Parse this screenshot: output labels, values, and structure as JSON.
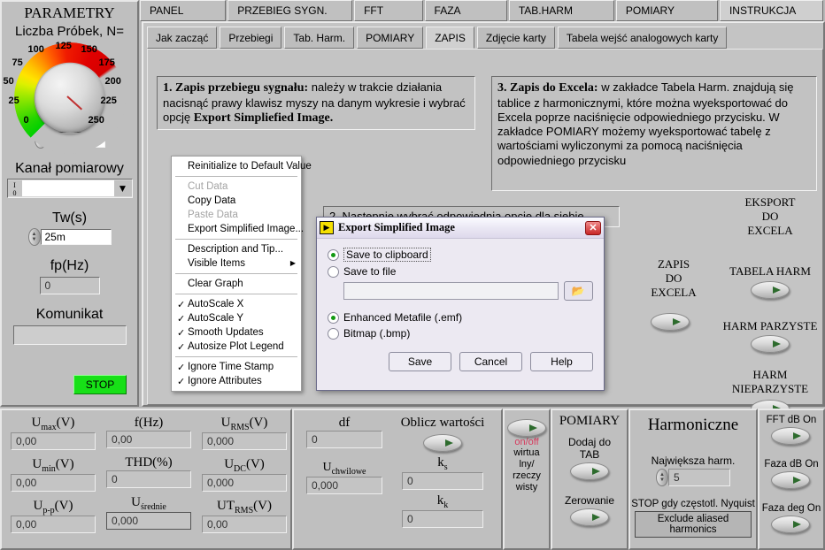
{
  "left_panel": {
    "title": "PARAMETRY",
    "samples_label": "Liczba Próbek, N=",
    "knob": {
      "value": "250",
      "ticks": [
        "0",
        "25",
        "50",
        "75",
        "100",
        "125",
        "150",
        "175",
        "200",
        "225",
        "250"
      ],
      "min": 0,
      "max": 250,
      "colors": {
        "low": "#00d000",
        "mid": "#ffe400",
        "high": "#d40000"
      }
    },
    "channel_label": "Kanał pomiarowy",
    "channel_value": "",
    "channel_io_icon": "io-icon",
    "tw_label": "Tw(s)",
    "tw_value": "25m",
    "fp_label": "fp(Hz)",
    "fp_value": "0",
    "komunikat_label": "Komunikat",
    "komunikat_value": "",
    "stop_label": "STOP",
    "stop_color": "#17e017"
  },
  "outer_tabs": [
    {
      "label": "PANEL",
      "selected": false
    },
    {
      "label": "PRZEBIEG SYGN.",
      "selected": false
    },
    {
      "label": "FFT",
      "selected": false
    },
    {
      "label": "FAZA",
      "selected": false
    },
    {
      "label": "TAB.HARM",
      "selected": false
    },
    {
      "label": "POMIARY",
      "selected": false
    },
    {
      "label": "INSTRUKCJA",
      "selected": true
    }
  ],
  "inner_tabs": [
    {
      "label": "Jak zacząć",
      "selected": false
    },
    {
      "label": "Przebiegi",
      "selected": false
    },
    {
      "label": "Tab. Harm.",
      "selected": false
    },
    {
      "label": "POMIARY",
      "selected": false
    },
    {
      "label": "ZAPIS",
      "selected": true
    },
    {
      "label": "Zdjęcie karty",
      "selected": false
    },
    {
      "label": "Tabela wejść analogowych karty",
      "selected": false
    }
  ],
  "instructions": {
    "step1_head": "1. Zapis przebiegu sygnału:",
    "step1_body": " należy w trakcie działania nacisnąć prawy klawisz myszy na danym wykresie i wybrać opcję ",
    "step1_emph": "Export Simpliefied Image.",
    "step2": "2. Następnie wybrać odpowiednią opcję dla siebie",
    "step3_head": "3. Zapis do Excela:",
    "step3_body": " w zakładce Tabela Harm. znajdują się tablice z harmonicznymi, które można wyeksportować do Excela poprze naciśnięcie odpowiedniego przycisku. W zakładce POMIARY możemy wyeksportować tabelę z wartościami wyliczonymi za pomocą naciśnięcia odpowiedniego przycisku"
  },
  "context_menu": [
    {
      "label": "Reinitialize to Default Value",
      "disabled": false,
      "checked": false,
      "submenu": false
    },
    {
      "sep": true
    },
    {
      "label": "Cut Data",
      "disabled": true,
      "checked": false,
      "submenu": false
    },
    {
      "label": "Copy Data",
      "disabled": false,
      "checked": false,
      "submenu": false
    },
    {
      "label": "Paste Data",
      "disabled": true,
      "checked": false,
      "submenu": false
    },
    {
      "label": "Export Simplified Image...",
      "disabled": false,
      "checked": false,
      "submenu": false
    },
    {
      "sep": true
    },
    {
      "label": "Description and Tip...",
      "disabled": false,
      "checked": false,
      "submenu": false
    },
    {
      "label": "Visible Items",
      "disabled": false,
      "checked": false,
      "submenu": true
    },
    {
      "sep": true
    },
    {
      "label": "Clear Graph",
      "disabled": false,
      "checked": false,
      "submenu": false
    },
    {
      "sep": true
    },
    {
      "label": "AutoScale X",
      "disabled": false,
      "checked": true,
      "submenu": false
    },
    {
      "label": "AutoScale Y",
      "disabled": false,
      "checked": true,
      "submenu": false
    },
    {
      "label": "Smooth Updates",
      "disabled": false,
      "checked": true,
      "submenu": false
    },
    {
      "label": "Autosize Plot Legend",
      "disabled": false,
      "checked": true,
      "submenu": false
    },
    {
      "sep": true
    },
    {
      "label": "Ignore Time Stamp",
      "disabled": false,
      "checked": true,
      "submenu": false
    },
    {
      "label": "Ignore Attributes",
      "disabled": false,
      "checked": true,
      "submenu": false
    }
  ],
  "dialog": {
    "title": "Export Simplified Image",
    "icon": "labview-export-icon",
    "close_glyph": "✕",
    "close_color": "#c82626",
    "dest_options": [
      {
        "label": "Save to clipboard",
        "selected": true,
        "focused": true
      },
      {
        "label": "Save to file",
        "selected": false,
        "focused": false
      }
    ],
    "file_path": "",
    "browse_icon": "folder-icon",
    "format_options": [
      {
        "label": "Enhanced Metafile (.emf)",
        "selected": true
      },
      {
        "label": "Bitmap (.bmp)",
        "selected": false
      }
    ],
    "buttons": [
      "Save",
      "Cancel",
      "Help"
    ]
  },
  "export_area": {
    "eksport_title": "EKSPORT\nDO\nEXCELA",
    "zapis_title": "ZAPIS\nDO\nEXCELA",
    "buttons": [
      {
        "label": "TABELA HARM"
      },
      {
        "label": "HARM PARZYSTE"
      },
      {
        "label": "HARM\nNIEPARZYSTE"
      }
    ]
  },
  "measurements": {
    "col1": [
      {
        "label": "Umax(V)",
        "sub": "max",
        "base": "U",
        "unit": "(V)",
        "value": "0,00"
      },
      {
        "label": "Umin(V)",
        "sub": "min",
        "base": "U",
        "unit": "(V)",
        "value": "0,00"
      },
      {
        "label": "Up-p(V)",
        "sub": "p-p",
        "base": "U",
        "unit": "(V)",
        "value": "0,00"
      }
    ],
    "col2": [
      {
        "base": "f",
        "sub": "",
        "unit": "(Hz)",
        "value": "0,00"
      },
      {
        "base": "THD",
        "sub": "",
        "unit": "(%)",
        "value": "0"
      },
      {
        "base": "U",
        "sub": "średnie",
        "unit": "",
        "value": "0,000",
        "bordered": true
      }
    ],
    "col3": [
      {
        "base": "U",
        "sub": "RMS",
        "unit": "(V)",
        "value": "0,000"
      },
      {
        "base": "U",
        "sub": "DC",
        "unit": "(V)",
        "value": "0,000"
      },
      {
        "base": "UT",
        "sub": "RMS",
        "unit": "(V)",
        "value": "0,00"
      }
    ]
  },
  "calc_panel": {
    "df_label": "df",
    "df_value": "0",
    "uchw_base": "U",
    "uchw_sub": "chwilowe",
    "uchw_value": "0,000",
    "oblicz_label": "Oblicz wartości",
    "ks_base": "k",
    "ks_sub": "s",
    "ks_value": "0",
    "kk_base": "k",
    "kk_sub": "k",
    "kk_value": "0"
  },
  "virtual_panel": {
    "onoff_label": "on/off",
    "onoff_color": "#d63b5e",
    "desc_lines": [
      "wirtua",
      "lny/",
      "rzeczy",
      "wisty"
    ]
  },
  "pomiary_panel": {
    "title": "POMIARY",
    "buttons": [
      {
        "label": "Dodaj do\nTAB"
      },
      {
        "label": "Zerowanie"
      }
    ]
  },
  "harmonic_panel": {
    "title": "Harmoniczne",
    "max_harm_label": "Największa harm.",
    "max_harm_value": "5",
    "nyquist_label": "STOP gdy częstotl. Nyquist",
    "exclude_label": "Exclude aliased  harmonics"
  },
  "toggle_panel": {
    "buttons": [
      {
        "label": "FFT dB On"
      },
      {
        "label": "Faza dB On"
      },
      {
        "label": "Faza deg On"
      }
    ]
  }
}
